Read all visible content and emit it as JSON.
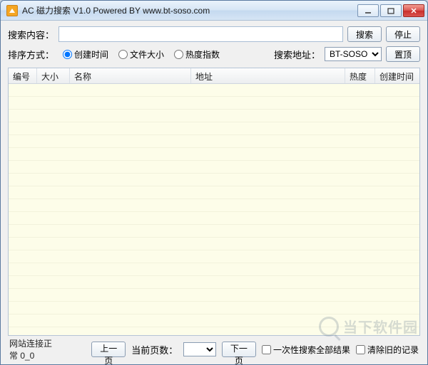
{
  "window": {
    "title": "AC 磁力搜索 V1.0 Powered BY www.bt-soso.com"
  },
  "search": {
    "label": "搜索内容：",
    "value": "",
    "placeholder": ""
  },
  "buttons": {
    "search": "搜索",
    "stop": "停止",
    "pin_top": "置顶",
    "prev_page": "上一页",
    "next_page": "下一页"
  },
  "sort": {
    "label": "排序方式：",
    "options": {
      "create_time": "创建时间",
      "file_size": "文件大小",
      "heat_index": "热度指数"
    },
    "selected": "create_time"
  },
  "address": {
    "label": "搜索地址：",
    "selected": "BT-SOSO"
  },
  "table": {
    "columns": {
      "index": "编号",
      "size": "大小",
      "name": "名称",
      "url": "地址",
      "heat": "热度",
      "create_time": "创建时间"
    },
    "rows": []
  },
  "footer": {
    "status": "网站连接正常 0_0",
    "page_label": "当前页数：",
    "current_page": "",
    "show_all_results": "一次性搜索全部结果",
    "clear_old_records": "清除旧的记录"
  },
  "watermark": "当下软件园"
}
